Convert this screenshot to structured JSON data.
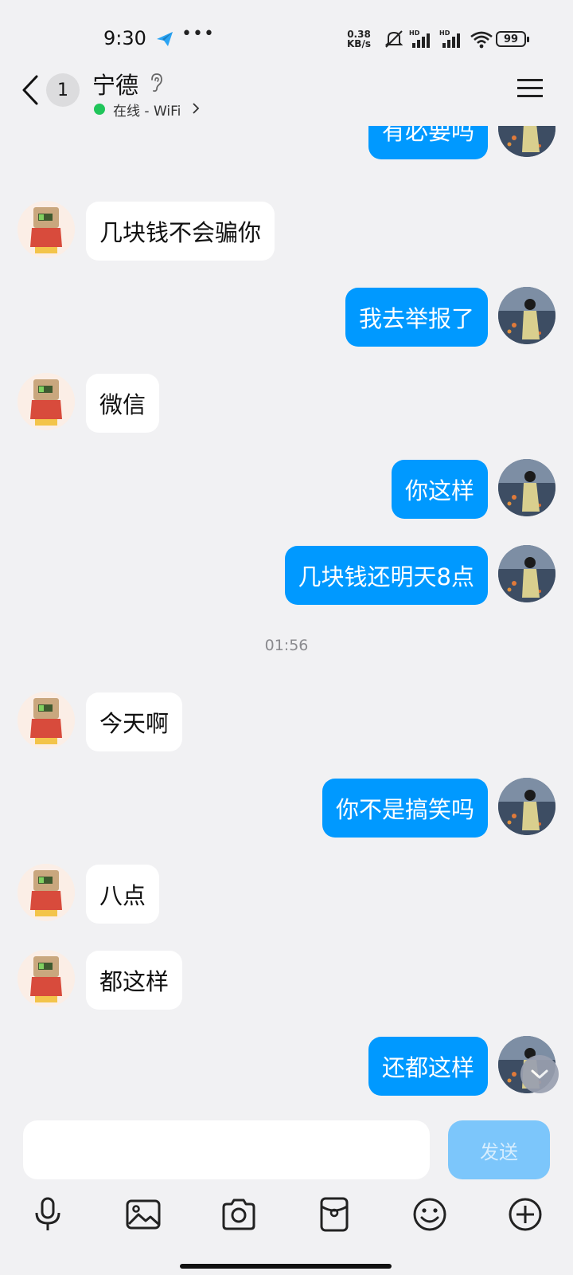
{
  "status_bar": {
    "time": "9:30",
    "net_speed_value": "0.38",
    "net_speed_unit": "KB/s",
    "battery": "99"
  },
  "header": {
    "unread_count": "1",
    "contact_name": "宁德",
    "online_status": "在线 - WiFi"
  },
  "messages": [
    {
      "side": "me",
      "text": "有必要吗"
    },
    {
      "side": "them",
      "text": "几块钱不会骗你"
    },
    {
      "side": "me",
      "text": "我去举报了"
    },
    {
      "side": "them",
      "text": "微信"
    },
    {
      "side": "me",
      "text": "你这样"
    },
    {
      "side": "me",
      "text": "几块钱还明天8点"
    },
    {
      "side": "time",
      "text": "01:56"
    },
    {
      "side": "them",
      "text": "今天啊"
    },
    {
      "side": "me",
      "text": "你不是搞笑吗"
    },
    {
      "side": "them",
      "text": "八点"
    },
    {
      "side": "them",
      "text": "都这样"
    },
    {
      "side": "me",
      "text": "还都这样"
    }
  ],
  "input": {
    "value": "",
    "placeholder": "",
    "send_label": "发送"
  },
  "toolbar_icons": [
    "microphone-icon",
    "image-icon",
    "camera-icon",
    "red-packet-icon",
    "emoji-icon",
    "plus-icon"
  ],
  "colors": {
    "accent": "#0099ff",
    "background": "#f1f1f3",
    "online": "#20c55a",
    "send_disabled": "#7cc6fb"
  }
}
